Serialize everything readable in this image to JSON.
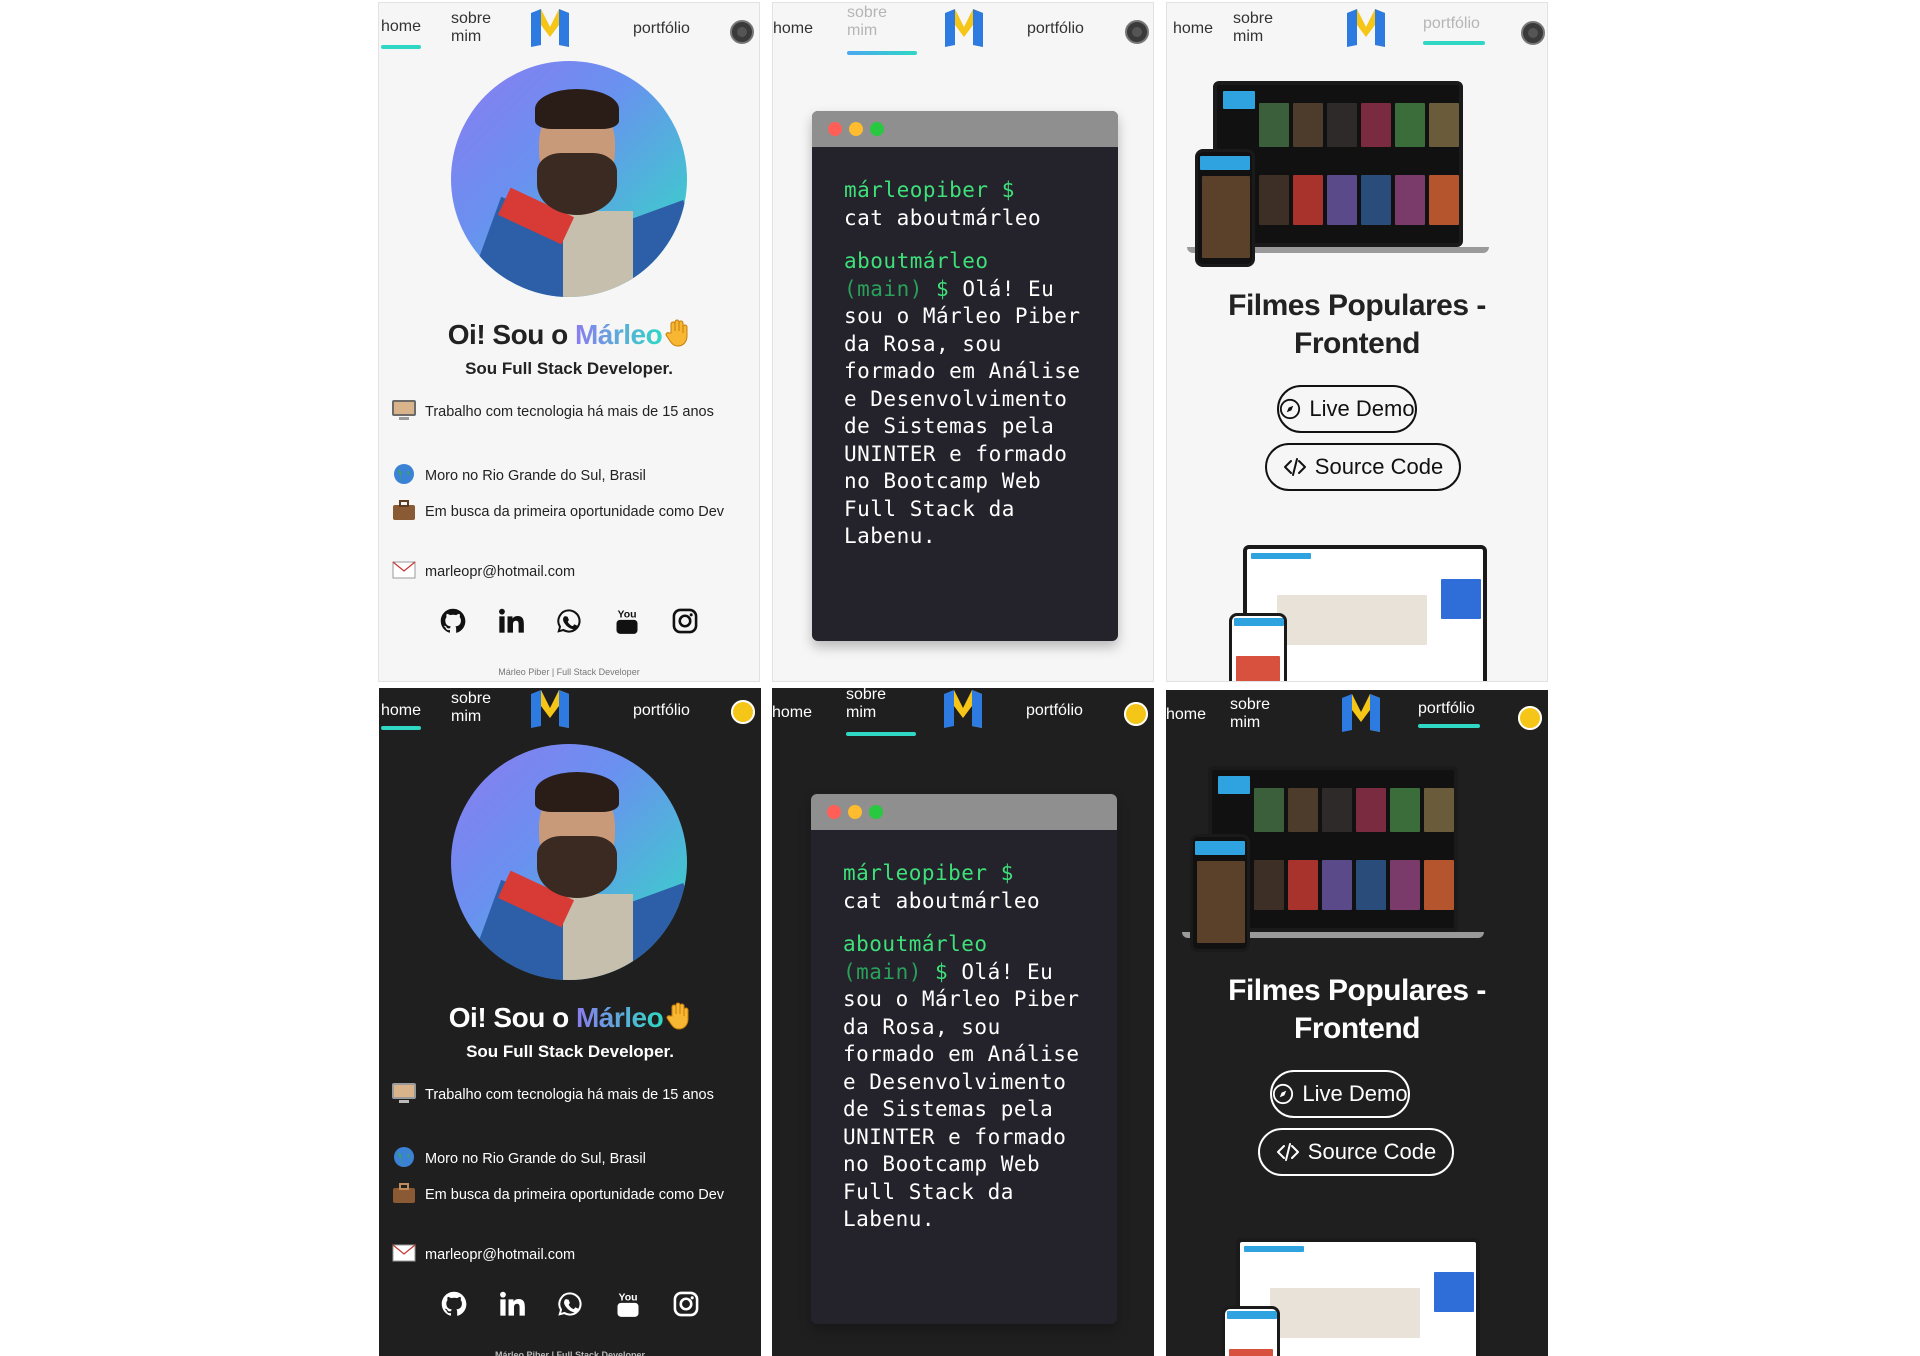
{
  "nav": {
    "home": "home",
    "about_l1": "sobre",
    "about_l2": "mim",
    "portfolio": "portfólio"
  },
  "home": {
    "greet_prefix": "Oi! Sou o",
    "greet_name": "Márleo",
    "role": "Sou Full Stack Developer.",
    "info": [
      {
        "icon": "computer-emoji-icon",
        "text": "Trabalho com tecnologia há mais de 15 anos"
      },
      {
        "icon": "globe-emoji-icon",
        "text": "Moro no Rio Grande do Sul, Brasil"
      },
      {
        "icon": "briefcase-emoji-icon",
        "text": "Em busca da primeira oportunidade como Dev"
      },
      {
        "icon": "envelope-emoji-icon",
        "text": "marleopr@hotmail.com"
      }
    ],
    "social": [
      "github-icon",
      "linkedin-icon",
      "whatsapp-icon",
      "youtube-icon",
      "instagram-icon"
    ],
    "footer": "Márleo Piber | Full Stack Developer"
  },
  "terminal": {
    "prompt_user": "márleopiber $",
    "command": "cat aboutmárleo",
    "dir": "aboutmárleo",
    "branch": "(main)",
    "dollar": "$",
    "text": "Olá! Eu sou o Márleo Piber da Rosa, sou formado em Análise e Desenvolvimento de Sistemas pela UNINTER e formado no Bootcamp Web Full Stack da Labenu."
  },
  "portfolio": {
    "project_title": "Filmes Populares - Frontend",
    "live_demo": "Live Demo",
    "source_code": "Source Code"
  },
  "colors": {
    "accent": "#2fd7c4",
    "name_gradient_start": "#8b7cf0",
    "terminal_green": "#3ee07a",
    "dark_bg": "#1f1f1f",
    "light_bg": "#f6f6f6"
  }
}
